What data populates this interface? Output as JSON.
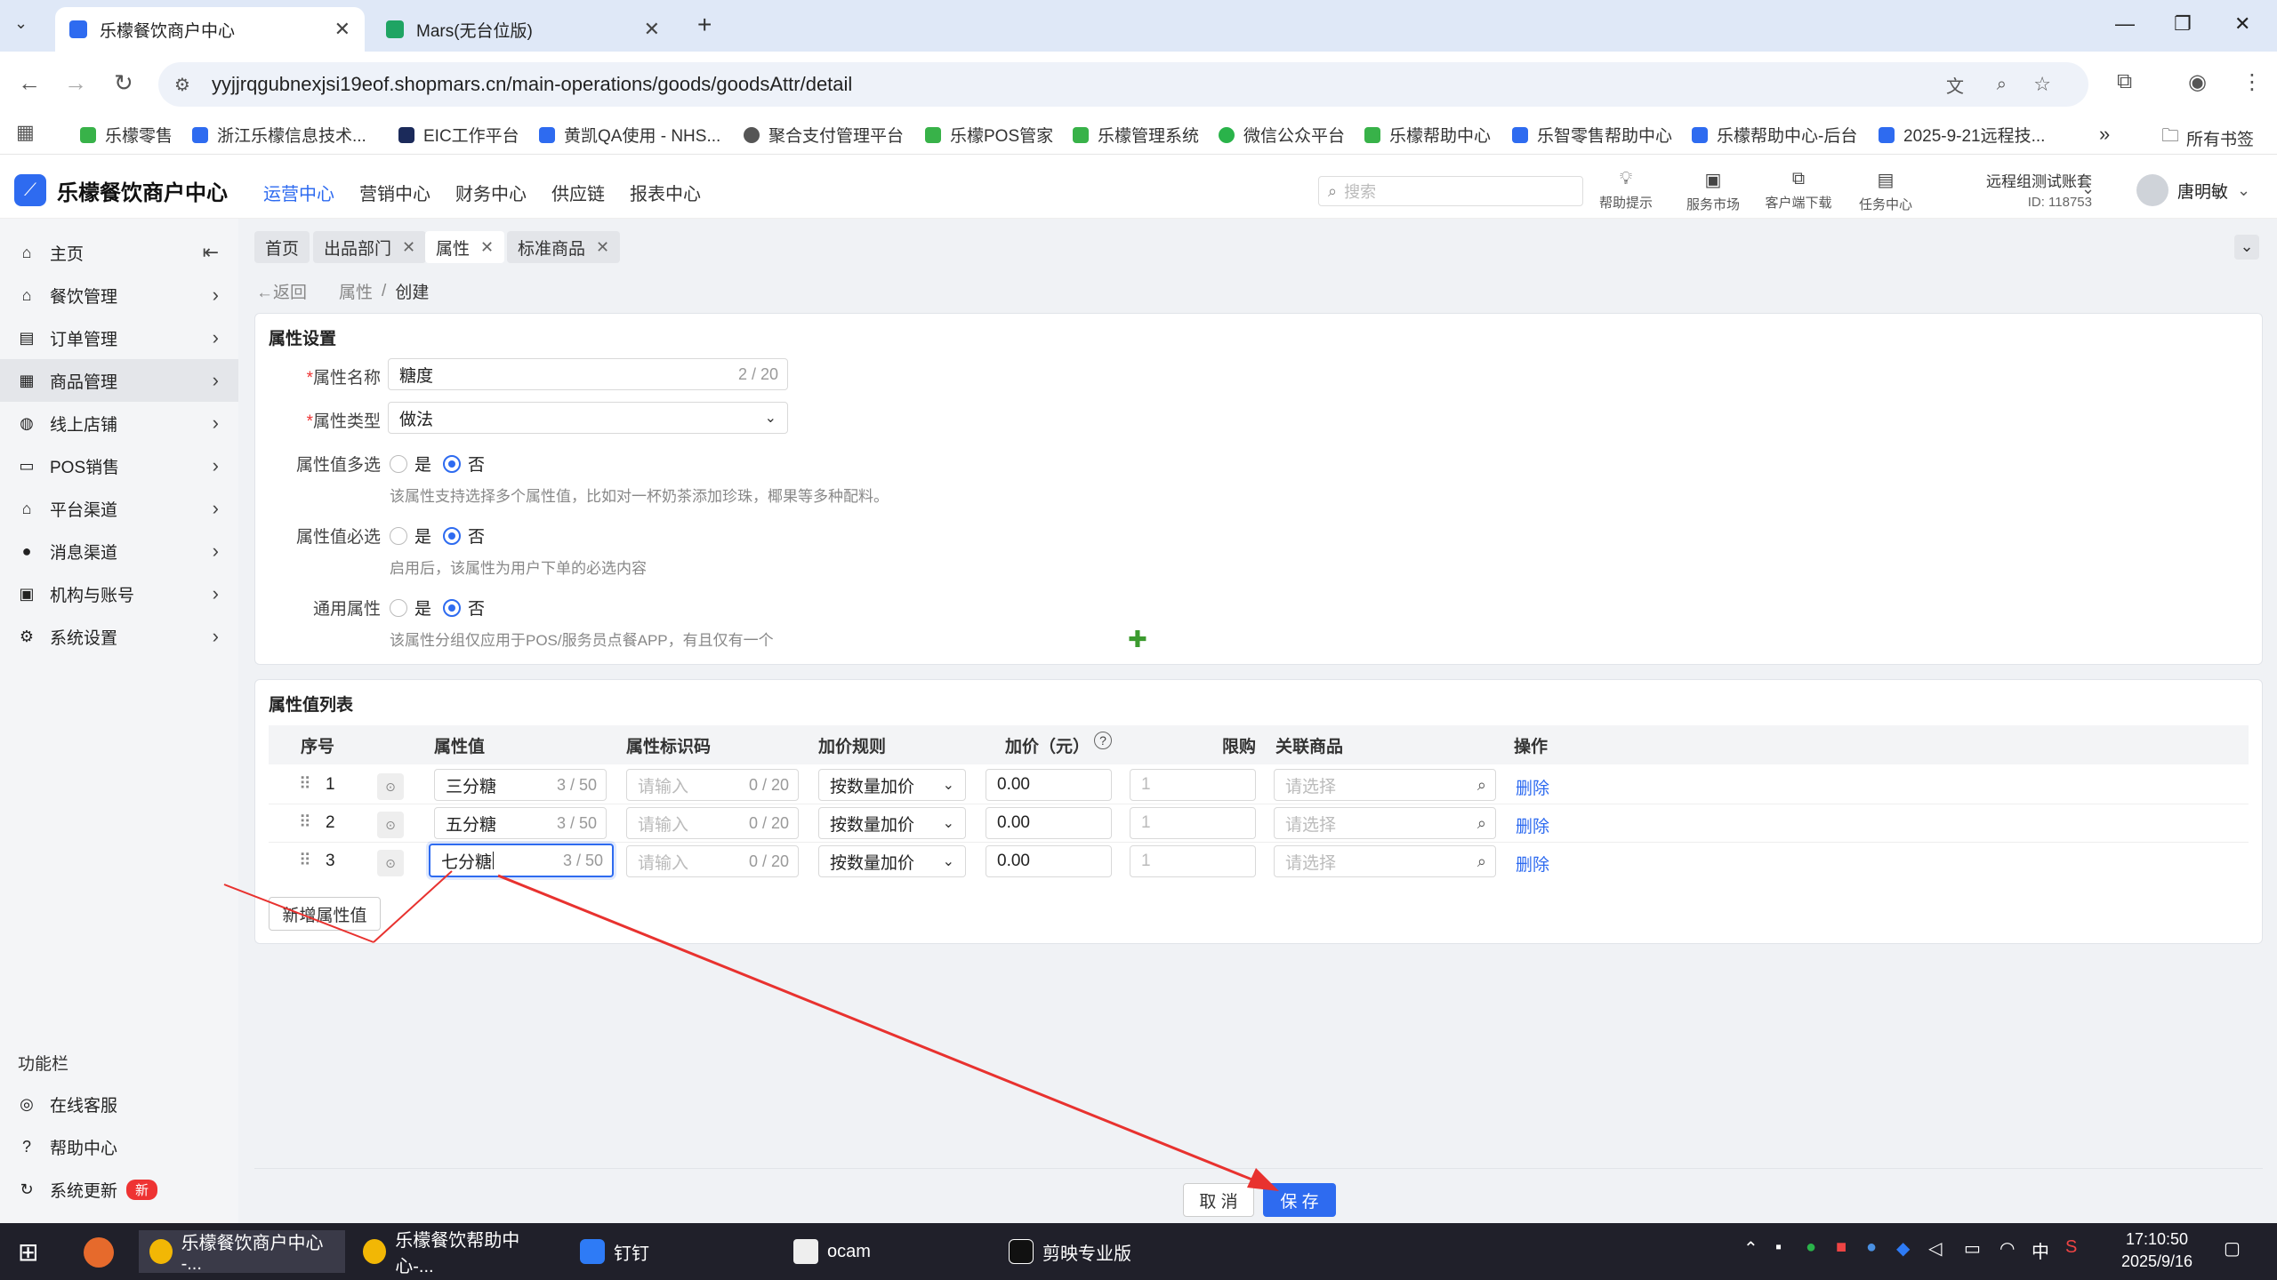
{
  "browser": {
    "tabs": [
      {
        "label": "乐檬餐饮商户中心",
        "active": true
      },
      {
        "label": "Mars(无台位版)",
        "active": false
      }
    ],
    "new_tab": "+",
    "url": "yyjjrqgubnexjsi19eof.shopmars.cn/main-operations/goods/goodsAttr/detail",
    "bookmarks": [
      "乐檬零售",
      "浙江乐檬信息技术...",
      "EIC工作平台",
      "黄凯QA使用 - NHS...",
      "聚合支付管理平台",
      "乐檬POS管家",
      "乐檬管理系统",
      "微信公众平台",
      "乐檬帮助中心",
      "乐智零售帮助中心",
      "乐檬帮助中心-后台",
      "2025-9-21远程技..."
    ],
    "all_bookmarks": "所有书签",
    "more": "»"
  },
  "app": {
    "logo": "乐檬餐饮商户中心",
    "nav": [
      {
        "label": "运营中心",
        "active": true
      },
      {
        "label": "营销中心"
      },
      {
        "label": "财务中心"
      },
      {
        "label": "供应链"
      },
      {
        "label": "报表中心"
      }
    ],
    "search_placeholder": "搜索",
    "tools": [
      "帮助提示",
      "服务市场",
      "客户端下载",
      "任务中心"
    ],
    "account": {
      "name": "远程组测试账套",
      "id": "ID: 118753"
    },
    "user": "唐明敏"
  },
  "sidebar": {
    "items": [
      {
        "label": "主页",
        "icon": "home-icon"
      },
      {
        "label": "餐饮管理",
        "icon": "store-icon"
      },
      {
        "label": "订单管理",
        "icon": "order-icon"
      },
      {
        "label": "商品管理",
        "icon": "goods-icon",
        "active": true
      },
      {
        "label": "线上店铺",
        "icon": "globe-icon"
      },
      {
        "label": "POS销售",
        "icon": "cart-icon"
      },
      {
        "label": "平台渠道",
        "icon": "bank-icon"
      },
      {
        "label": "消息渠道",
        "icon": "message-icon"
      },
      {
        "label": "机构与账号",
        "icon": "id-card-icon"
      },
      {
        "label": "系统设置",
        "icon": "gear-icon"
      }
    ],
    "func_title": "功能栏",
    "func_items": [
      {
        "label": "在线客服"
      },
      {
        "label": "帮助中心"
      },
      {
        "label": "系统更新",
        "badge": "新"
      }
    ]
  },
  "page_tabs": [
    {
      "label": "首页",
      "closable": false
    },
    {
      "label": "出品部门",
      "closable": true
    },
    {
      "label": "属性",
      "closable": true,
      "active": true
    },
    {
      "label": "标准商品",
      "closable": true
    }
  ],
  "crumb": {
    "back": "返回",
    "path1": "属性",
    "sep": "/",
    "path2": "创建"
  },
  "settings": {
    "title": "属性设置",
    "name_label": "属性名称",
    "name_value": "糖度",
    "name_count": "2 / 20",
    "type_label": "属性类型",
    "type_value": "做法",
    "multi_label": "属性值多选",
    "multi_hint": "该属性支持选择多个属性值，比如对一杯奶茶添加珍珠，椰果等多种配料。",
    "required_label": "属性值必选",
    "required_hint": "启用后，该属性为用户下单的必选内容",
    "common_label": "通用属性",
    "common_hint": "该属性分组仅应用于POS/服务员点餐APP，有且仅有一个",
    "yes": "是",
    "no": "否"
  },
  "list": {
    "title": "属性值列表",
    "headers": [
      "序号",
      "属性值",
      "属性标识码",
      "加价规则",
      "加价（元）",
      "限购",
      "关联商品",
      "操作"
    ],
    "rows": [
      {
        "no": "1",
        "value": "三分糖",
        "value_count": "3 / 50",
        "code_ph": "请输入",
        "code_count": "0 / 20",
        "rule": "按数量加价",
        "price": "0.00",
        "limit": "1",
        "goods_ph": "请选择",
        "action": "删除"
      },
      {
        "no": "2",
        "value": "五分糖",
        "value_count": "3 / 50",
        "code_ph": "请输入",
        "code_count": "0 / 20",
        "rule": "按数量加价",
        "price": "0.00",
        "limit": "1",
        "goods_ph": "请选择",
        "action": "删除"
      },
      {
        "no": "3",
        "value": "七分糖",
        "value_count": "3 / 50",
        "code_ph": "请输入",
        "code_count": "0 / 20",
        "rule": "按数量加价",
        "price": "0.00",
        "limit": "1",
        "goods_ph": "请选择",
        "action": "删除"
      }
    ],
    "add_button": "新增属性值"
  },
  "footer": {
    "cancel": "取 消",
    "save": "保 存"
  },
  "taskbar": {
    "items": [
      {
        "label": "乐檬餐饮商户中心 -...",
        "active": true
      },
      {
        "label": "乐檬餐饮帮助中心-..."
      },
      {
        "label": "钉钉"
      },
      {
        "label": "ocam"
      },
      {
        "label": "剪映专业版"
      }
    ],
    "ime": "中",
    "time": "17:10:50",
    "date": "2025/9/16"
  },
  "colors": {
    "accent": "#2e6bf0",
    "annotation": "#e8322f",
    "danger": "#e33"
  }
}
